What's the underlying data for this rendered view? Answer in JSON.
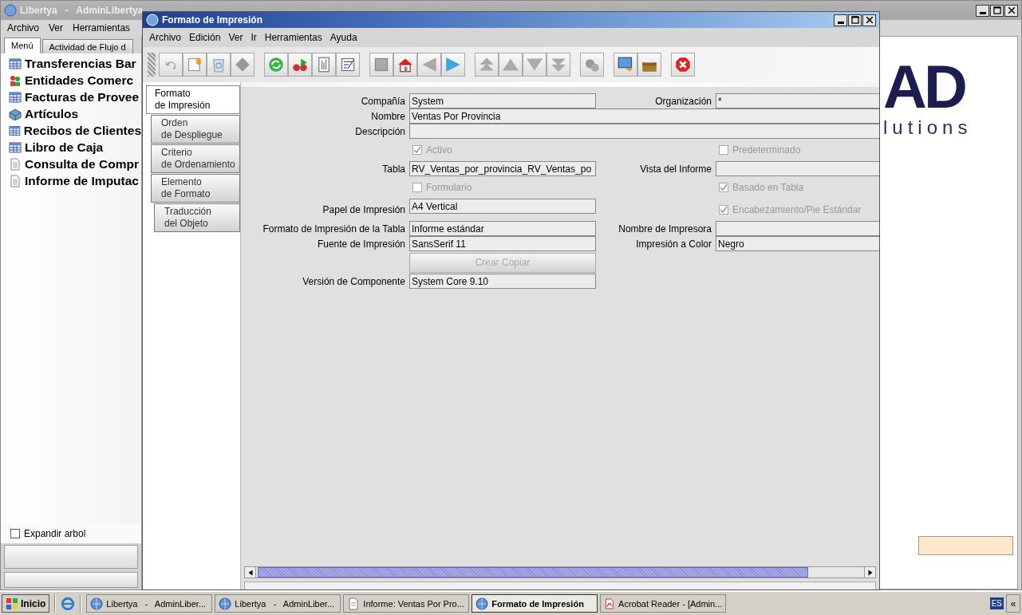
{
  "back_window": {
    "title": "Libertya   -   AdminLibertya",
    "menu": [
      "Archivo",
      "Ver",
      "Herramientas"
    ],
    "tabs": [
      {
        "label": "Menú",
        "selected": true
      },
      {
        "label": "Actividad de Flujo d",
        "selected": false
      }
    ],
    "tree": [
      {
        "label": "Transferencias Bar",
        "kind": "window"
      },
      {
        "label": "Entidades Comerc",
        "kind": "entity"
      },
      {
        "label": "Facturas de Provee",
        "kind": "window"
      },
      {
        "label": "Artículos",
        "kind": "product"
      },
      {
        "label": "Recibos de Clientes",
        "kind": "window"
      },
      {
        "label": "Libro de Caja",
        "kind": "window"
      },
      {
        "label": "Consulta de Compr",
        "kind": "report"
      },
      {
        "label": "Informe de Imputac",
        "kind": "report"
      }
    ],
    "expand_tree": {
      "label": "Expandir arbol",
      "checked": false
    },
    "logo": {
      "mark": "AD",
      "tagline": "lutions"
    }
  },
  "window": {
    "title": "Formato de Impresión",
    "menu": [
      "Archivo",
      "Edición",
      "Ver",
      "Ir",
      "Herramientas",
      "Ayuda"
    ],
    "tabs": [
      {
        "label": "Formato\nde Impresión",
        "selected": true
      },
      {
        "label": "Orden\nde Despliegue",
        "selected": false
      },
      {
        "label": "Criterio\nde Ordenamiento",
        "selected": false
      },
      {
        "label": "Elemento\nde Formato",
        "selected": false
      },
      {
        "label": "Traducción\ndel Objeto",
        "selected": false
      }
    ],
    "form": {
      "rows": [
        {
          "left": {
            "kind": "field",
            "label": "Compañía",
            "value": "System"
          },
          "right": {
            "kind": "field",
            "label": "Organización",
            "value": "*"
          }
        },
        {
          "left": {
            "kind": "wide",
            "label": "Nombre",
            "value": "Ventas Por Provincia"
          }
        },
        {
          "left": {
            "kind": "wide",
            "label": "Descripción"
          }
        },
        {
          "left": {
            "kind": "checkbox",
            "label": "Activo",
            "checked": true,
            "disabled": true
          },
          "right": {
            "kind": "checkbox",
            "label": "Predeterminado",
            "checked": false,
            "disabled": true
          }
        },
        {
          "left": {
            "kind": "field",
            "label": "Tabla",
            "value": "RV_Ventas_por_provincia_RV_Ventas_po"
          },
          "right": {
            "kind": "field",
            "label": "Vista del Informe"
          }
        },
        {
          "left": {
            "kind": "checkbox",
            "label": "Formulario",
            "checked": false,
            "disabled": true
          },
          "right": {
            "kind": "checkbox",
            "label": "Basado en Tabla",
            "checked": true,
            "disabled": true
          }
        },
        {
          "left": {
            "kind": "field",
            "label": "Papel de Impresión",
            "value": "A4 Vertical"
          },
          "right": {
            "kind": "checkbox",
            "label": "Encabezamiento/Pie Estándar",
            "checked": true,
            "disabled": true
          }
        },
        {
          "left": {
            "kind": "field",
            "label": "Formato de Impresión de la Tabla",
            "value": "Informe estándar"
          },
          "right": {
            "kind": "field",
            "label": "Nombre de Impresora"
          }
        },
        {
          "left": {
            "kind": "field",
            "label": "Fuente de Impresión",
            "value": "SansSerif 11"
          },
          "right": {
            "kind": "field",
            "label": "Impresión a Color",
            "value": "Negro"
          }
        },
        {
          "left": {
            "kind": "button",
            "label": "Crear Copiar",
            "disabled": true
          }
        },
        {
          "left": {
            "kind": "field",
            "label": "Versión de Componente",
            "value": "System Core 9.10"
          }
        }
      ]
    }
  },
  "taskbar": {
    "start": "Inicio",
    "tasks": [
      {
        "label": "Libertya   -   AdminLiber...",
        "kind": "app",
        "selected": false
      },
      {
        "label": "Libertya   -   AdminLiber...",
        "kind": "app",
        "selected": false
      },
      {
        "label": "Informe: Ventas Por Pro...",
        "kind": "document",
        "selected": false
      },
      {
        "label": "Formato de Impresión",
        "kind": "app",
        "selected": true
      },
      {
        "label": "Acrobat Reader - [Admin...",
        "kind": "pdf",
        "selected": false
      }
    ],
    "language": "ES",
    "tray_toggle": "«"
  }
}
